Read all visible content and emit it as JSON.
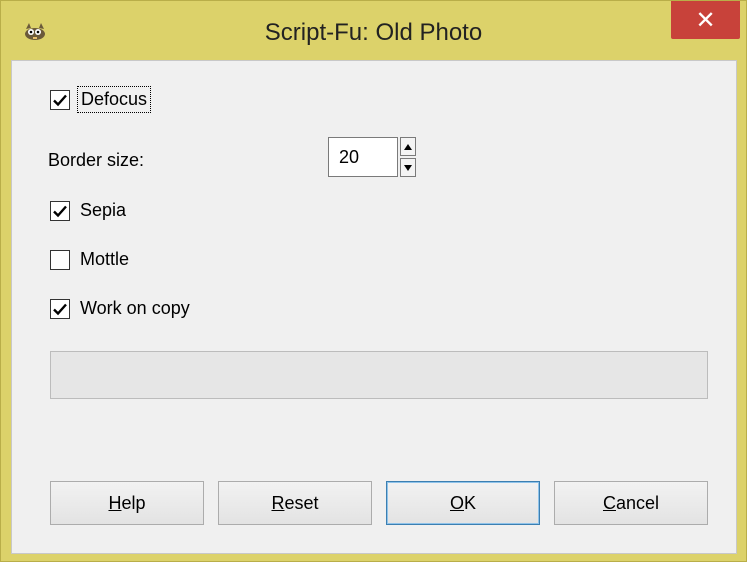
{
  "window": {
    "title": "Script-Fu: Old Photo",
    "close_glyph": "✕",
    "icon": "gimp-wilber-icon",
    "accent_color": "#dcd26a",
    "close_color": "#c8423a"
  },
  "options": {
    "defocus": {
      "label": "Defocus",
      "checked": true
    },
    "border_size": {
      "label": "Border size:",
      "value": "20"
    },
    "sepia": {
      "label": "Sepia",
      "checked": true
    },
    "mottle": {
      "label": "Mottle",
      "checked": false
    },
    "work_on_copy": {
      "label": "Work on copy",
      "checked": true
    }
  },
  "progress": {
    "value": 0
  },
  "buttons": {
    "help": {
      "mnemonic": "H",
      "rest": "elp"
    },
    "reset": {
      "mnemonic": "R",
      "rest": "eset"
    },
    "ok": {
      "mnemonic": "O",
      "rest": "K"
    },
    "cancel": {
      "mnemonic": "C",
      "rest": "ancel"
    }
  }
}
